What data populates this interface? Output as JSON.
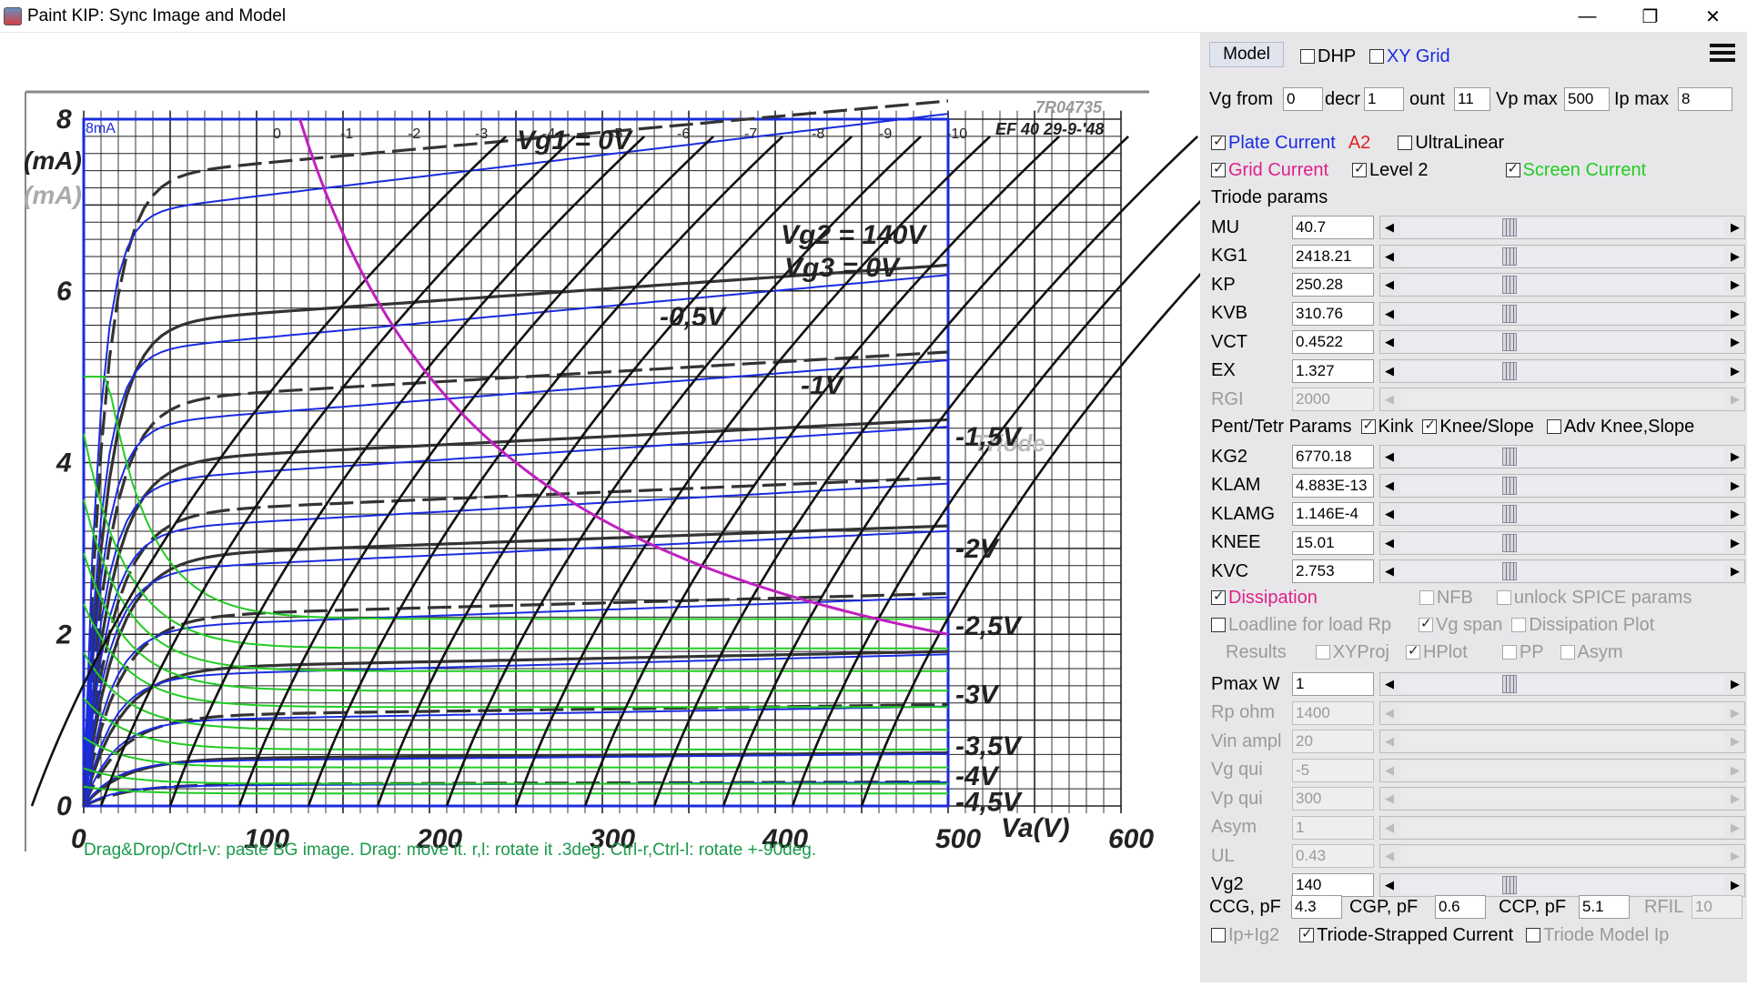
{
  "window": {
    "title": "Paint KIP: Sync Image and Model",
    "minimize": "—",
    "restore": "❐",
    "close": "✕"
  },
  "graph": {
    "stamp": "7R04735",
    "tube_label": "EF 40 29-9-'48",
    "current_unit": "(mA)",
    "current_unit_2": "(mA)",
    "current_label": "8mA",
    "x_ticks": [
      "0",
      "100",
      "200",
      "300",
      "400",
      "500",
      "600"
    ],
    "y_ticks": [
      "0",
      "2",
      "4",
      "6",
      "8"
    ],
    "x_axis_label": "Va(V)",
    "vg1_label": "Vg1 = 0V",
    "vg2_label": "Vg2 = 140V",
    "vg3_label": "Vg3 = 0V",
    "curve_labels": [
      "-0,5V",
      "-1V",
      "-1,5V",
      "-2V",
      "-2,5V",
      "-3V",
      "-3,5V",
      "-4V",
      "-4,5V"
    ],
    "top_grid_labels": [
      "0",
      "-1",
      "-2",
      "-3",
      "-4",
      "-5",
      "-6",
      "-7",
      "-8",
      "-9",
      "-10"
    ],
    "side_text": "Triode",
    "hint": "Drag&Drop/Ctrl-v: paste BG image. Drag: move it. r,l: rotate it .3deg. Ctrl-r,Ctrl-l: rotate +-90deg."
  },
  "panel": {
    "model_button": "Model",
    "dhp": "DHP",
    "xy_grid": "XY Grid",
    "vg_from_label": "Vg from",
    "vg_from": "0",
    "decr_label": "decr",
    "decr": "1",
    "count_label": "ount",
    "count": "11",
    "vp_max_label": "Vp max",
    "vp_max": "500",
    "ip_max_label": "Ip max",
    "ip_max": "8",
    "plate_current": "Plate Current",
    "a2": "A2",
    "ultralinear": "UltraLinear",
    "grid_current": "Grid Current",
    "level2": "Level 2",
    "screen_current": "Screen Current",
    "triode_params": "Triode params",
    "triode": [
      {
        "name": "MU",
        "value": "40.7",
        "enabled": true
      },
      {
        "name": "KG1",
        "value": "2418.21",
        "enabled": true
      },
      {
        "name": "KP",
        "value": "250.28",
        "enabled": true
      },
      {
        "name": "KVB",
        "value": "310.76",
        "enabled": true
      },
      {
        "name": "VCT",
        "value": "0.4522",
        "enabled": true
      },
      {
        "name": "EX",
        "value": "1.327",
        "enabled": true
      },
      {
        "name": "RGI",
        "value": "2000",
        "enabled": false
      }
    ],
    "pent_params": "Pent/Tetr Params",
    "kink": "Kink",
    "knee_slope": "Knee/Slope",
    "adv_knee": "Adv Knee,Slope",
    "pent": [
      {
        "name": "KG2",
        "value": "6770.18",
        "enabled": true
      },
      {
        "name": "KLAM",
        "value": "4.883E-13",
        "enabled": true
      },
      {
        "name": "KLAMG",
        "value": "1.146E-4",
        "enabled": true
      },
      {
        "name": "KNEE",
        "value": "15.01",
        "enabled": true
      },
      {
        "name": "KVC",
        "value": "2.753",
        "enabled": true
      }
    ],
    "dissipation": "Dissipation",
    "nfb": "NFB",
    "unlock_spice": "unlock SPICE params",
    "loadline": "Loadline for load Rp",
    "vg_span": "Vg span",
    "dissipation_plot": "Dissipation Plot",
    "results": "Results",
    "xyproj": "XYProj",
    "hplot": "HPlot",
    "pp": "PP",
    "asym": "Asym",
    "lower": [
      {
        "name": "Pmax W",
        "value": "1",
        "enabled": true
      },
      {
        "name": "Rp ohm",
        "value": "1400",
        "enabled": false
      },
      {
        "name": "Vin ampl",
        "value": "20",
        "enabled": false
      },
      {
        "name": "Vg qui",
        "value": "-5",
        "enabled": false
      },
      {
        "name": "Vp qui",
        "value": "300",
        "enabled": false
      },
      {
        "name": "Asym",
        "value": "1",
        "enabled": false
      },
      {
        "name": "UL",
        "value": "0.43",
        "enabled": false
      },
      {
        "name": "Vg2",
        "value": "140",
        "enabled": true
      }
    ],
    "ccg_label": "CCG, pF",
    "ccg": "4.3",
    "cgp_label": "CGP, pF",
    "cgp": "0.6",
    "ccp_label": "CCP, pF",
    "ccp": "5.1",
    "rfil_label": "RFIL",
    "rfil": "10",
    "ip_ig2": "Ip+Ig2",
    "triode_strapped": "Triode-Strapped Current",
    "triode_model_ip": "Triode Model Ip"
  },
  "colors": {
    "accent_blue": "#1a2be0",
    "grid_current_magenta": "#e0208a",
    "screen_green": "#22cc22",
    "dissipation_magenta": "#c020c0",
    "hint_green": "#1a9a4a",
    "a2_red": "#e02020"
  }
}
